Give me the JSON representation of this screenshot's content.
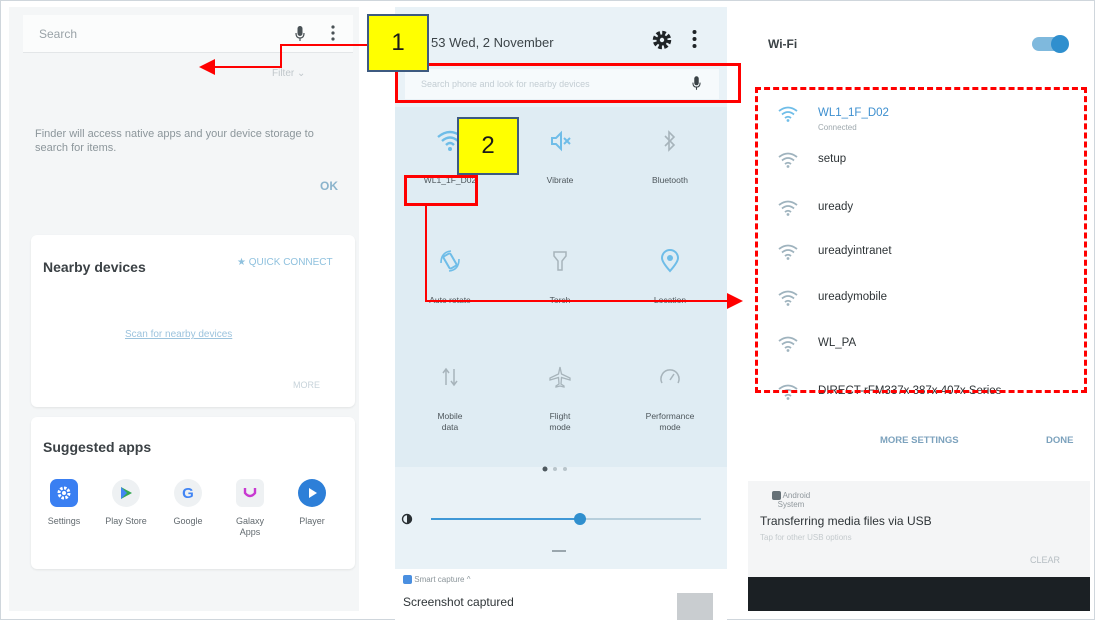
{
  "finder": {
    "search_placeholder": "Search",
    "filter_label": "Filter",
    "info_text": "Finder will access native apps and your device storage to search for items.",
    "ok_label": "OK",
    "nearby": {
      "title": "Nearby devices",
      "quick_connect": "QUICK CONNECT",
      "scan_link": "Scan for nearby devices",
      "more_label": "MORE"
    },
    "suggested": {
      "title": "Suggested apps",
      "apps": [
        {
          "label": "Settings",
          "icon": "gear-icon",
          "color": "#3a7ff2"
        },
        {
          "label": "Play Store",
          "icon": "play-store-icon",
          "color": "#eef1f3"
        },
        {
          "label": "Google",
          "icon": "google-icon",
          "color": "#eef1f3"
        },
        {
          "label": "Galaxy\nApps",
          "icon": "galaxy-apps-icon",
          "color": "#eef1f3"
        },
        {
          "label": "Player",
          "icon": "player-icon",
          "color": "#2d7fd8"
        }
      ]
    }
  },
  "quick_panel": {
    "datetime": "53 Wed, 2 November",
    "search_placeholder": "Search phone and look for nearby devices",
    "tiles": [
      {
        "label": "WL1_1F_D02",
        "icon": "wifi-icon"
      },
      {
        "label": "Vibrate",
        "icon": "vibrate-icon"
      },
      {
        "label": "Bluetooth",
        "icon": "bluetooth-icon"
      },
      {
        "label": "Auto rotate",
        "icon": "auto-rotate-icon"
      },
      {
        "label": "Torch",
        "icon": "torch-icon"
      },
      {
        "label": "Location",
        "icon": "location-icon"
      },
      {
        "label": "Mobile\ndata",
        "icon": "mobile-data-icon"
      },
      {
        "label": "Flight\nmode",
        "icon": "airplane-icon"
      },
      {
        "label": "Performance\nmode",
        "icon": "performance-icon"
      }
    ],
    "brightness": 0.55,
    "notification": {
      "app": "Smart capture ^",
      "title": "Screenshot captured"
    }
  },
  "wifi": {
    "title": "Wi-Fi",
    "enabled": true,
    "networks": [
      {
        "name": "WL1_1F_D02",
        "status": "Connected",
        "connected": true
      },
      {
        "name": "setup",
        "status": ""
      },
      {
        "name": "uready",
        "status": ""
      },
      {
        "name": "ureadyintranet",
        "status": ""
      },
      {
        "name": "ureadymobile",
        "status": ""
      },
      {
        "name": "WL_PA",
        "status": ""
      },
      {
        "name": "DIRECT-rFM337x 387x 407x Series",
        "status": ""
      }
    ],
    "more_settings": "MORE SETTINGS",
    "done": "DONE",
    "notification": {
      "app": "Android System",
      "title": "Transferring media files via USB",
      "subtitle": "Tap for other USB options",
      "clear": "CLEAR"
    }
  },
  "annotations": {
    "step1": "1",
    "step2": "2",
    "accent_color": "#ff0000",
    "badge_color": "#ffff00"
  }
}
